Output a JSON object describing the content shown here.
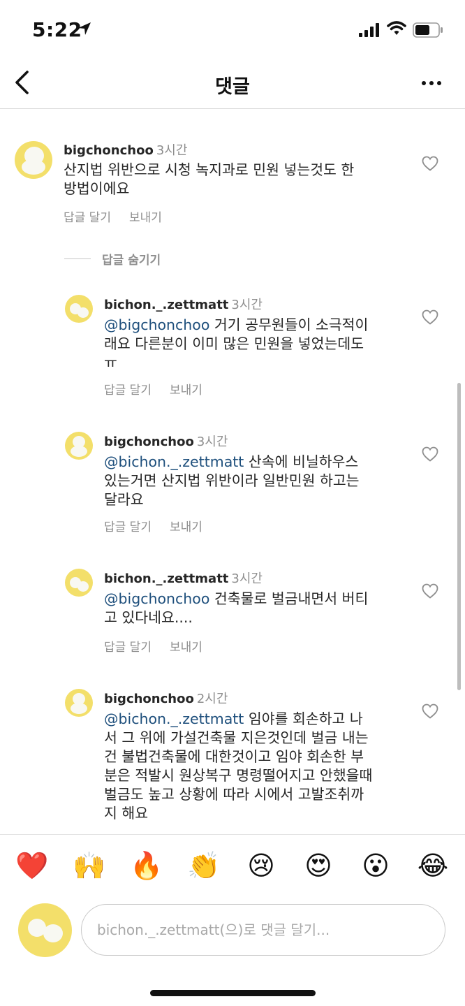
{
  "status_bar": {
    "time": "5:22"
  },
  "header": {
    "title": "댓글"
  },
  "hide_replies_label": "답글 숨기기",
  "comments": [
    {
      "user": "bigchonchoo",
      "time": "3시간",
      "mention": "",
      "lines": [
        "산지법 위반으로 시청 녹지과로 민원 넣는것도  한",
        "방법이에요"
      ],
      "reply_label": "답글 달기",
      "send_label": "보내기"
    },
    {
      "user": "bichon._.zettmatt",
      "time": "3시간",
      "mention": "@bigchonchoo",
      "lines": [
        " 거기 공무원들이 소극적이",
        "래요 다른분이 이미 많은 민원을 넣었는데도",
        "ㅠ"
      ],
      "reply_label": "답글 달기",
      "send_label": "보내기"
    },
    {
      "user": "bigchonchoo",
      "time": "3시간",
      "mention": "@bichon._.zettmatt",
      "lines": [
        " 산속에 비닐하우스",
        "있는거면 산지법 위반이라 일반민원 하고는",
        "달라요"
      ],
      "reply_label": "답글 달기",
      "send_label": "보내기"
    },
    {
      "user": "bichon._.zettmatt",
      "time": "3시간",
      "mention": "@bigchonchoo",
      "lines": [
        " 건축물로 벌금내면서 버티",
        "고 있다네요...."
      ],
      "reply_label": "답글 달기",
      "send_label": "보내기"
    },
    {
      "user": "bigchonchoo",
      "time": "2시간",
      "mention": "@bichon._.zettmatt",
      "lines": [
        " 임야를 회손하고 나",
        "서 그 위에 가설건축물 지은것인데 벌금 내는",
        "건 불법건축물에 대한것이고 임야 회손한 부",
        "분은 적발시 원상복구 명령떨어지고 안했을때",
        "벌금도 높고 상황에 따라 시에서 고발조취까",
        "지 해요"
      ]
    }
  ],
  "emojis": [
    "❤️",
    "🙌",
    "🔥",
    "👏",
    "😢",
    "😍",
    "😮",
    "😂"
  ],
  "composer": {
    "placeholder": "bichon._.zettmatt(으)로 댓글 달기..."
  }
}
